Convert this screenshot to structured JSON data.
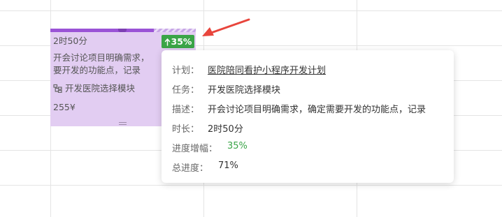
{
  "colors": {
    "card_bg": "#e2cdf2",
    "progress_fill": "#9a53d6",
    "badge_green": "#3aa547",
    "pointer_red": "#e8453c"
  },
  "card": {
    "duration": "2时50分",
    "desc_line1": "开会讨论项目明确需求，",
    "desc_line2": "要开发的功能点，记录",
    "module_icon": "tree-structure-icon",
    "module": "开发医院选择模块",
    "cost": "255¥",
    "progress_fraction": 0.71
  },
  "badge": {
    "icon": "arrow-up-icon",
    "text": "35%"
  },
  "tooltip": {
    "plan_label": "计划：",
    "plan_value": "医院陪同看护小程序开发计划",
    "task_label": "任务：",
    "task_value": "开发医院选择模块",
    "desc_label": "描述：",
    "desc_value": "开会讨论项目明确需求，确定需要开发的功能点，记录",
    "duration_label": "时长：",
    "duration_value": "2时50分",
    "increment_label": "进度增幅：",
    "increment_value": "35%",
    "total_label": "总进度：",
    "total_value": "71%"
  }
}
